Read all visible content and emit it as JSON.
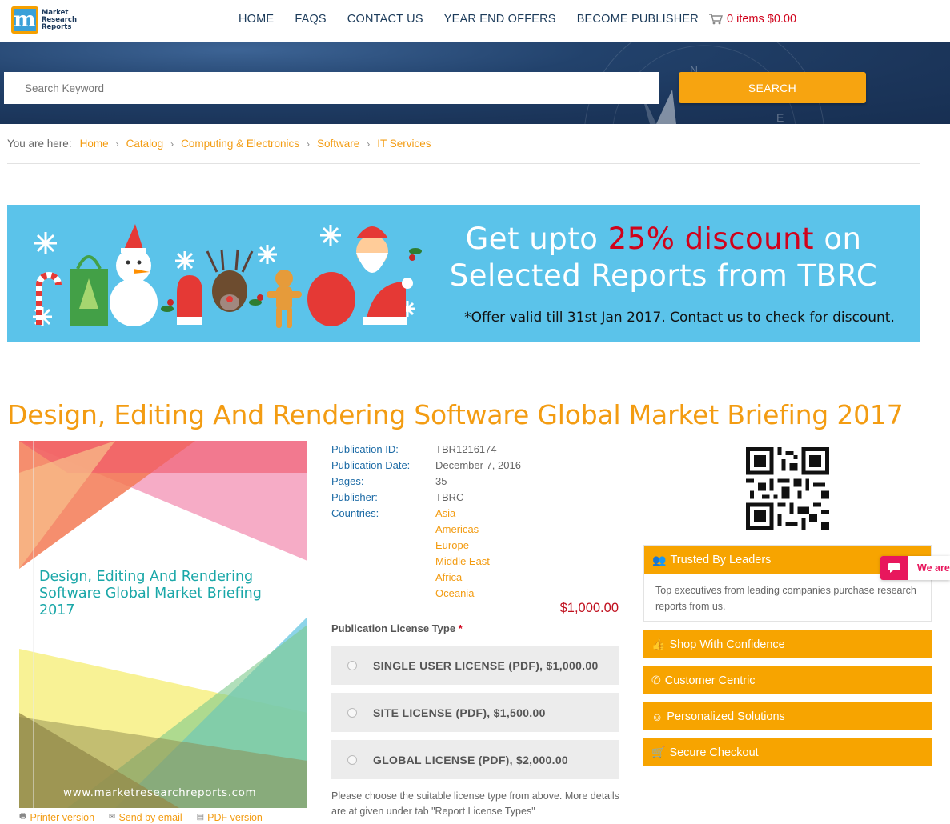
{
  "header": {
    "logo_text": [
      "Market",
      "Research",
      "Reports"
    ],
    "nav": [
      "HOME",
      "FAQS",
      "CONTACT US",
      "YEAR END OFFERS",
      "BECOME PUBLISHER"
    ],
    "cart": "0 items $0.00"
  },
  "search": {
    "placeholder": "Search Keyword",
    "button": "SEARCH"
  },
  "breadcrumb": {
    "label": "You are here:",
    "items": [
      "Home",
      "Catalog",
      "Computing & Electronics",
      "Software",
      "IT Services"
    ]
  },
  "banner": {
    "line1_prefix": "Get upto",
    "line1_highlight": "25% discount",
    "line1_suffix": "on",
    "line2": "Selected Reports from TBRC",
    "note": "*Offer valid till 31st Jan 2017. Contact us to check for discount."
  },
  "report": {
    "title": "Design, Editing And Rendering Software Global Market Briefing 2017",
    "cover_title": "Design, Editing And Rendering Software Global Market Briefing 2017",
    "cover_url": "www.marketresearchreports.com",
    "meta": [
      {
        "key": "Publication ID:",
        "value": "TBR1216174"
      },
      {
        "key": "Publication Date:",
        "value": "December 7, 2016"
      },
      {
        "key": "Pages:",
        "value": "35"
      },
      {
        "key": "Publisher:",
        "value": "TBRC"
      }
    ],
    "countries_label": "Countries:",
    "countries": [
      "Asia",
      "Americas",
      "Europe",
      "Middle East",
      "Africa",
      "Oceania"
    ],
    "price": "$1,000.00",
    "license_title": "Publication License Type",
    "license_required": "*",
    "licenses": [
      "SINGLE USER LICENSE (PDF), $1,000.00",
      "SITE LICENSE (PDF), $1,500.00",
      "GLOBAL LICENSE (PDF), $2,000.00"
    ],
    "license_note": "Please choose the suitable license type from above. More details are at given under tab \"Report License Types\"",
    "doc_links": [
      "Printer version",
      "Send by email",
      "PDF version"
    ]
  },
  "sidebar": {
    "trusted_title": "Trusted By Leaders",
    "trusted_text": "Top executives from leading companies purchase research reports from us.",
    "boxes": [
      {
        "label": "Shop With Confidence",
        "icon": "thumbs-up-icon"
      },
      {
        "label": "Customer Centric",
        "icon": "phone-icon"
      },
      {
        "label": "Personalized Solutions",
        "icon": "smile-icon"
      },
      {
        "label": "Secure Checkout",
        "icon": "cart-icon"
      }
    ]
  },
  "chat": {
    "label": "We are"
  },
  "colors": {
    "accent": "#f7a400",
    "link": "#f39c12",
    "nav": "#1c3b5a",
    "banner": "#5bc3ea",
    "price": "#c0111f"
  }
}
